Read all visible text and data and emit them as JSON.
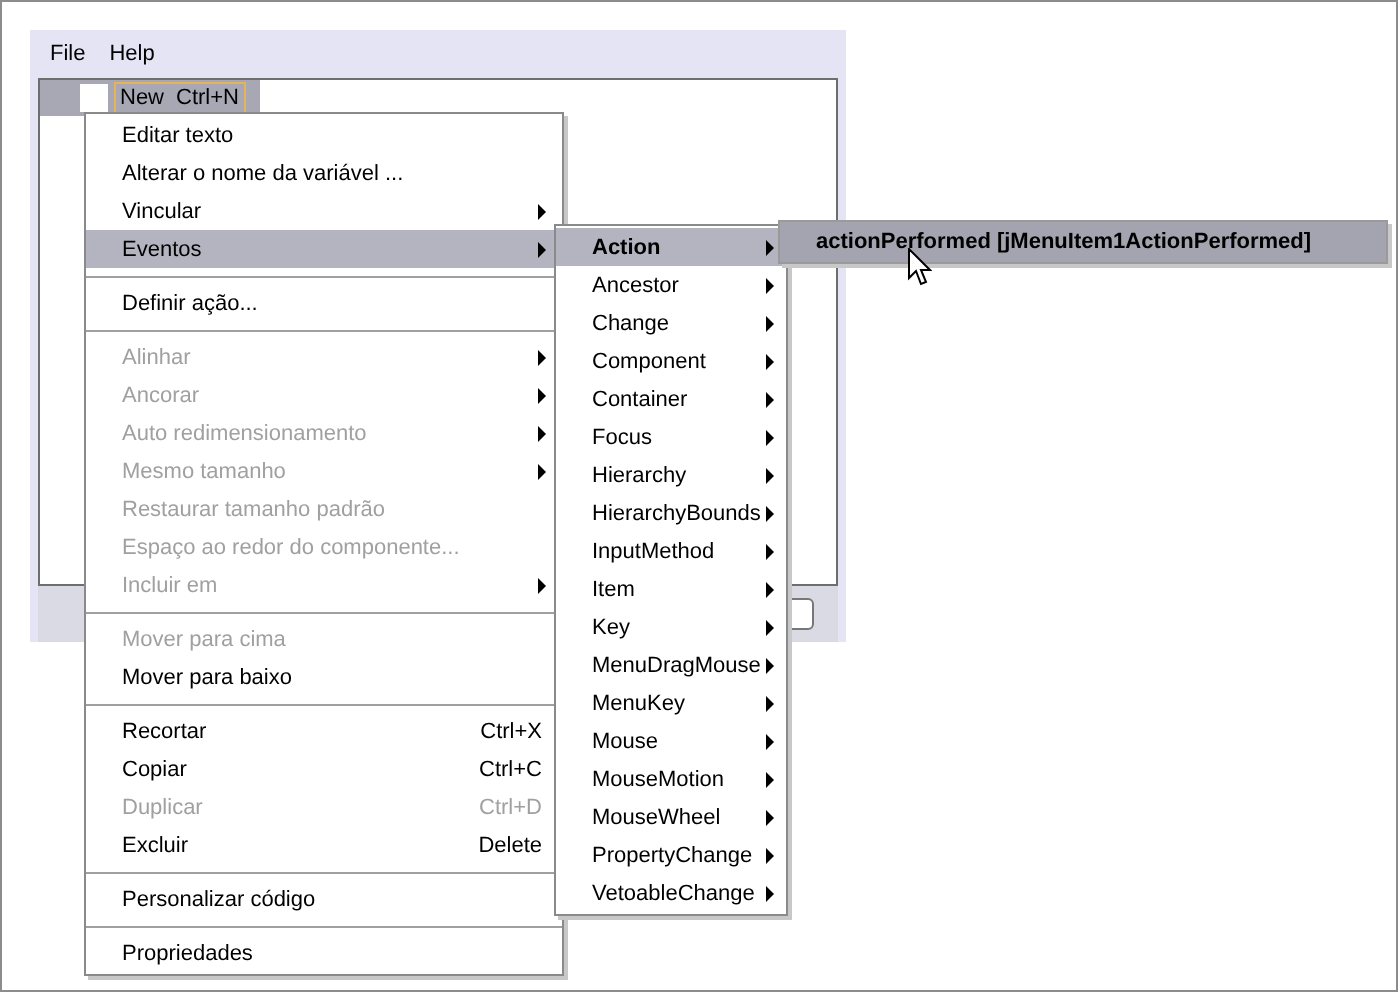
{
  "menubar": [
    "File",
    "Help"
  ],
  "designer": {
    "menu_item": {
      "label": "New",
      "shortcut": "Ctrl+N",
      "selected": true
    }
  },
  "context_menu": {
    "groups": [
      [
        {
          "label": "Editar texto",
          "disabled": false,
          "submenu": false,
          "selected": false
        },
        {
          "label": "Alterar o nome da variável ...",
          "disabled": false,
          "submenu": false,
          "selected": false
        },
        {
          "label": "Vincular",
          "disabled": false,
          "submenu": true,
          "selected": false
        },
        {
          "label": "Eventos",
          "disabled": false,
          "submenu": true,
          "selected": true
        }
      ],
      [
        {
          "label": "Definir ação...",
          "disabled": false,
          "submenu": false,
          "selected": false
        }
      ],
      [
        {
          "label": "Alinhar",
          "disabled": true,
          "submenu": true,
          "selected": false
        },
        {
          "label": "Ancorar",
          "disabled": true,
          "submenu": true,
          "selected": false
        },
        {
          "label": "Auto redimensionamento",
          "disabled": true,
          "submenu": true,
          "selected": false
        },
        {
          "label": "Mesmo tamanho",
          "disabled": true,
          "submenu": true,
          "selected": false
        },
        {
          "label": "Restaurar tamanho padrão",
          "disabled": true,
          "submenu": false,
          "selected": false
        },
        {
          "label": "Espaço ao redor do componente...",
          "disabled": true,
          "submenu": false,
          "selected": false
        },
        {
          "label": "Incluir em",
          "disabled": true,
          "submenu": true,
          "selected": false
        }
      ],
      [
        {
          "label": "Mover para cima",
          "disabled": true,
          "submenu": false,
          "selected": false
        },
        {
          "label": "Mover para baixo",
          "disabled": false,
          "submenu": false,
          "selected": false
        }
      ],
      [
        {
          "label": "Recortar",
          "shortcut": "Ctrl+X",
          "disabled": false,
          "submenu": false,
          "selected": false
        },
        {
          "label": "Copiar",
          "shortcut": "Ctrl+C",
          "disabled": false,
          "submenu": false,
          "selected": false
        },
        {
          "label": "Duplicar",
          "shortcut": "Ctrl+D",
          "disabled": true,
          "submenu": false,
          "selected": false
        },
        {
          "label": "Excluir",
          "shortcut": "Delete",
          "disabled": false,
          "submenu": false,
          "selected": false
        }
      ],
      [
        {
          "label": "Personalizar código",
          "disabled": false,
          "submenu": false,
          "selected": false
        }
      ],
      [
        {
          "label": "Propriedades",
          "disabled": false,
          "submenu": false,
          "selected": false
        }
      ]
    ]
  },
  "events_submenu": [
    {
      "label": "Action",
      "selected": true
    },
    {
      "label": "Ancestor",
      "selected": false
    },
    {
      "label": "Change",
      "selected": false
    },
    {
      "label": "Component",
      "selected": false
    },
    {
      "label": "Container",
      "selected": false
    },
    {
      "label": "Focus",
      "selected": false
    },
    {
      "label": "Hierarchy",
      "selected": false
    },
    {
      "label": "HierarchyBounds",
      "selected": false
    },
    {
      "label": "InputMethod",
      "selected": false
    },
    {
      "label": "Item",
      "selected": false
    },
    {
      "label": "Key",
      "selected": false
    },
    {
      "label": "MenuDragMouse",
      "selected": false
    },
    {
      "label": "MenuKey",
      "selected": false
    },
    {
      "label": "Mouse",
      "selected": false
    },
    {
      "label": "MouseMotion",
      "selected": false
    },
    {
      "label": "MouseWheel",
      "selected": false
    },
    {
      "label": "PropertyChange",
      "selected": false
    },
    {
      "label": "VetoableChange",
      "selected": false
    }
  ],
  "action_submenu": [
    {
      "label": "actionPerformed [jMenuItem1ActionPerformed]",
      "selected": true
    }
  ]
}
